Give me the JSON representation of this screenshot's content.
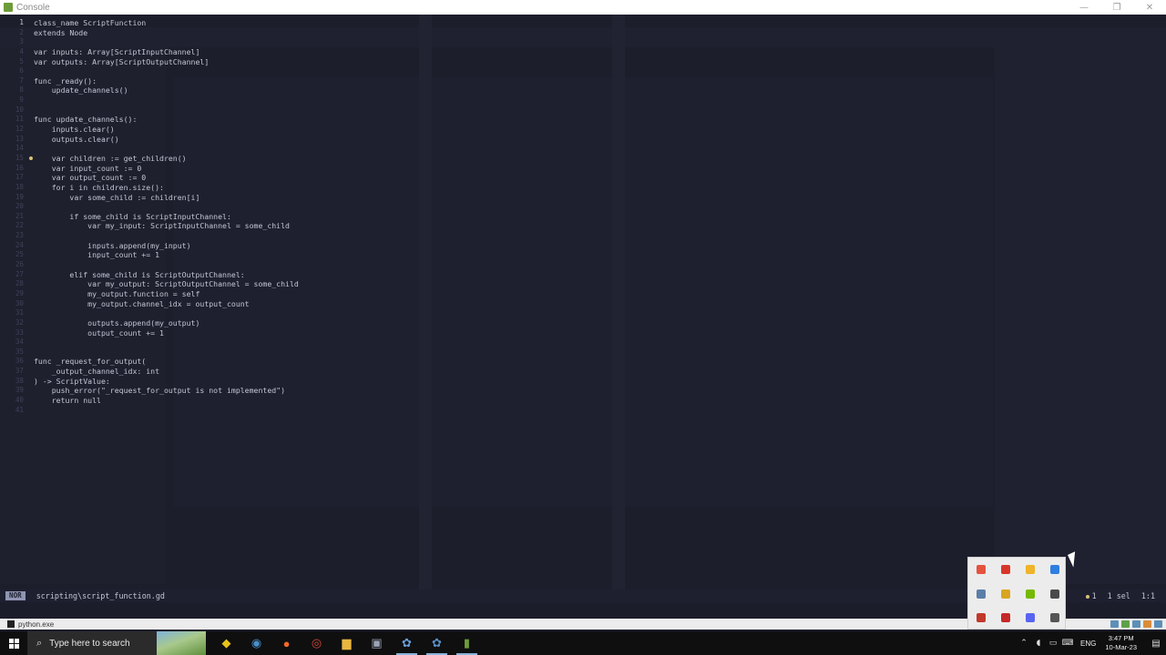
{
  "window": {
    "title": "Console",
    "controls": [
      "—",
      "❐",
      "✕"
    ]
  },
  "editor": {
    "current_line": 1,
    "marker_line": 15,
    "lines": [
      "class_name ScriptFunction",
      "extends Node",
      "",
      "var inputs: Array[ScriptInputChannel]",
      "var outputs: Array[ScriptOutputChannel]",
      "",
      "func _ready():",
      "    update_channels()",
      "",
      "",
      "func update_channels():",
      "    inputs.clear()",
      "    outputs.clear()",
      "",
      "    var children := get_children()",
      "    var input_count := 0",
      "    var output_count := 0",
      "    for i in children.size():",
      "        var some_child := children[i]",
      "",
      "        if some_child is ScriptInputChannel:",
      "            var my_input: ScriptInputChannel = some_child",
      "",
      "            inputs.append(my_input)",
      "            input_count += 1",
      "",
      "        elif some_child is ScriptOutputChannel:",
      "            var my_output: ScriptOutputChannel = some_child",
      "            my_output.function = self",
      "            my_output.channel_idx = output_count",
      "",
      "            outputs.append(my_output)",
      "            output_count += 1",
      "",
      "",
      "func _request_for_output(",
      "    _output_channel_idx: int",
      ") -> ScriptValue:",
      "    push_error(\"_request_for_output is not implemented\")",
      "    return null",
      ""
    ]
  },
  "statusline": {
    "mode": "NOR",
    "file": "scripting\\script_function.gd",
    "diagnostics": "1",
    "selection": "1 sel",
    "position": "1:1"
  },
  "procbar": {
    "process": "python.exe"
  },
  "taskbar": {
    "search_placeholder": "Type here to search",
    "search_icon": "magnifier-icon",
    "apps": [
      {
        "name": "explorer-icon",
        "glyph": "◆",
        "color": "#e8c21a"
      },
      {
        "name": "steam-icon",
        "glyph": "◉",
        "color": "#4a90c9"
      },
      {
        "name": "firefox-icon",
        "glyph": "●",
        "color": "#f2682a"
      },
      {
        "name": "chrome-icon",
        "glyph": "◎",
        "color": "#d94a3d"
      },
      {
        "name": "folder-icon",
        "glyph": "▆",
        "color": "#e9b73f"
      },
      {
        "name": "terminal-icon",
        "glyph": "▣",
        "color": "#9aa3b5"
      },
      {
        "name": "godot-icon",
        "glyph": "✿",
        "color": "#6a9fd8"
      },
      {
        "name": "godot-icon-2",
        "glyph": "✿",
        "color": "#5a8fc8"
      },
      {
        "name": "console-icon",
        "glyph": "▮",
        "color": "#6d9b3a"
      }
    ],
    "language": "ENG",
    "time": "3:47 PM",
    "date": "10-Mar-23"
  },
  "tray_popup": {
    "icons": [
      {
        "name": "security-icon",
        "color": "#e5533d"
      },
      {
        "name": "shield-icon",
        "color": "#d9362b"
      },
      {
        "name": "chrome-tray-icon",
        "color": "#f0b429"
      },
      {
        "name": "bluetooth-icon",
        "color": "#2f7fe0"
      },
      {
        "name": "network-drive-icon",
        "color": "#5a7ea8"
      },
      {
        "name": "folder-sync-icon",
        "color": "#d9a520"
      },
      {
        "name": "nvidia-icon",
        "color": "#76b900"
      },
      {
        "name": "usb-icon",
        "color": "#4a4a4a"
      },
      {
        "name": "calendar-icon",
        "color": "#c0392b"
      },
      {
        "name": "red-app-icon",
        "color": "#c62828"
      },
      {
        "name": "discord-icon",
        "color": "#5865f2"
      },
      {
        "name": "settings-tray-icon",
        "color": "#555555"
      }
    ]
  }
}
